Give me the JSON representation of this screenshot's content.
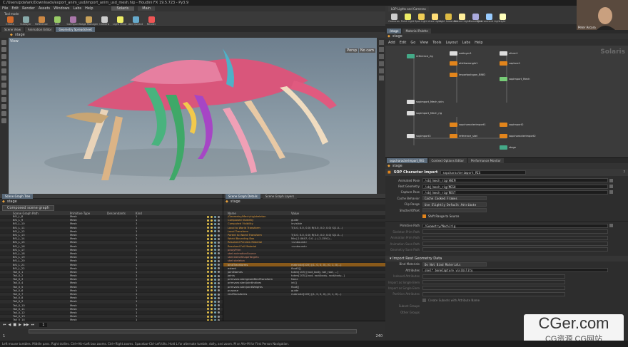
{
  "app": {
    "title": "C:/Users/pdafark/Downloads/export_anim_usd/import_anim_usd_mesh.hip - Houdini FX 19.5.723 - Py3.9",
    "menus": [
      "File",
      "Edit",
      "Render",
      "Assets",
      "Windows",
      "Labs",
      "Help"
    ],
    "desktop": "Solaris",
    "main_label": "Main"
  },
  "shelf": {
    "left_tab": "Tool mode",
    "tools": [
      "Create",
      "Sublayer",
      "Reference",
      "Edit",
      "Configure",
      "Stage Manager",
      "Camera",
      "Light Mixer",
      "Add Variant",
      "Render"
    ],
    "right_tools": [
      "Cameras",
      "Point Light",
      "Spot Light",
      "Area Light",
      "Light Instancer",
      "Distant Light",
      "Domelight",
      "Environment Light",
      "Light"
    ],
    "right_tab": "LOP Lights and Cameras"
  },
  "left_tabs": [
    "Scene View",
    "Animation Editor",
    "Geometry Spreadsheet"
  ],
  "viewport": {
    "stage_label": "stage",
    "view_label": "View",
    "persp": "Persp",
    "no_cam": "No cam"
  },
  "scene_graph": {
    "tab": "Scene Graph Tree",
    "path": "stage",
    "collection": "Composed scene graph",
    "columns": [
      "Scene Graph Path",
      "Primitive Type",
      "Descendants",
      "Kind"
    ],
    "rows": [
      [
        "Bf1_L_8",
        "Mesh",
        "",
        "1"
      ],
      [
        "Bf1_L_9",
        "Mesh",
        "",
        "1"
      ],
      [
        "Bf1_L_10",
        "Mesh",
        "",
        "1"
      ],
      [
        "Bf1_L_11",
        "Mesh",
        "",
        "1"
      ],
      [
        "Bf1_L_12",
        "Mesh",
        "",
        "1"
      ],
      [
        "Bf1_L_13",
        "Mesh",
        "",
        "1"
      ],
      [
        "Bf1_L_14",
        "Mesh",
        "",
        "1"
      ],
      [
        "Bf1_L_15",
        "Mesh",
        "",
        "1"
      ],
      [
        "Bf1_L_16",
        "Mesh",
        "",
        "1"
      ],
      [
        "Bf1_L_17",
        "Mesh",
        "",
        "1"
      ],
      [
        "Bf1_L_18",
        "Mesh",
        "",
        "1"
      ],
      [
        "Bf1_L_19",
        "Mesh",
        "",
        "1"
      ],
      [
        "Bf1_L_20",
        "Mesh",
        "",
        "1"
      ],
      [
        "Bf1_L_21",
        "Mesh",
        "",
        "1"
      ],
      [
        "Bf1_L_22",
        "Mesh",
        "",
        "1"
      ],
      [
        "Tail_0_1",
        "Mesh",
        "",
        "1"
      ],
      [
        "Tail_0_2",
        "Mesh",
        "",
        "1"
      ],
      [
        "Tail_0_3",
        "Mesh",
        "",
        "1"
      ],
      [
        "Tail_0_4",
        "Mesh",
        "",
        "1"
      ],
      [
        "Tail_0_5",
        "Mesh",
        "",
        "1"
      ],
      [
        "Tail_0_6",
        "Mesh",
        "",
        "1"
      ],
      [
        "Tail_0_7",
        "Mesh",
        "",
        "1"
      ],
      [
        "Tail_0_8",
        "Mesh",
        "",
        "1"
      ],
      [
        "Tail_0_9",
        "Mesh",
        "",
        "1"
      ],
      [
        "Tail_0_10",
        "Mesh",
        "",
        "1"
      ],
      [
        "Tail_0_11",
        "Mesh",
        "",
        "1"
      ],
      [
        "Tail_0_12",
        "Mesh",
        "",
        "1"
      ],
      [
        "Tail_0_13",
        "Mesh",
        "",
        "1"
      ],
      [
        "Tail_0_14",
        "Mesh",
        "",
        "1"
      ],
      [
        "Tail_0_15",
        "Mesh",
        "",
        "1"
      ],
      [
        "Tail_0_16",
        "Mesh",
        "",
        "1"
      ],
      [
        "Tail_0_17",
        "Mesh",
        "",
        "1"
      ],
      [
        "Skeleton",
        "Skeleton",
        "",
        "1"
      ],
      [
        "Skel",
        "SkelAnimation",
        "",
        ""
      ],
      [
        "Xform",
        "Xform",
        "22",
        ""
      ]
    ]
  },
  "details": {
    "tabs": [
      "Scene Graph Details",
      "Scene Graph Layers"
    ],
    "path": "stage",
    "columns": [
      "Name",
      "Value"
    ],
    "rows": [
      [
        "/Geometry/Mech/rig/skeleton",
        ""
      ],
      [
        "Composed Visibility",
        "guide"
      ],
      [
        "Computed Visibility",
        "invisible"
      ],
      [
        "Local to World Transform",
        "T(0.0, 0.0, 0.0) R(0.0, 0.0, 0.0) S(1.0...)"
      ],
      [
        "Local Transform",
        ""
      ],
      [
        "Parent to World Transform",
        "T(0.0, 0.0, 0.0) R(0.0, 0.0, 0.0) S(1.0...)"
      ],
      [
        "World Bounding Box",
        "Min(-2.0647, 0.0...) (-2.1591)..."
      ],
      [
        "Resolved Preview Material",
        "<unbound>"
      ],
      [
        "Resolved Full Material",
        "<unbound>"
      ],
      [
        "proxyPrim",
        ""
      ],
      [
        "skel:animationSource",
        ""
      ],
      [
        "skel:blendShapeTargets",
        ""
      ],
      [
        "skel:skeleton",
        ""
      ],
      [
        "bindTransforms",
        "matrix4d[105] ((1, 0, 0, 0), (0, 1, 0)...)"
      ],
      [
        "extent",
        "float3[]"
      ],
      [
        "jointNames",
        "token[105] [root_body, tail_root, ...]"
      ],
      [
        "joints",
        "token[105] [root, root/body, root/body...]"
      ],
      [
        "primvars:skel:geomBindTransform",
        "None"
      ],
      [
        "primvars:skel:jointIndices",
        "int[]"
      ],
      [
        "primvars:skel:jointWeights",
        "float[]"
      ],
      [
        "purpose",
        "guide"
      ],
      [
        "restTransforms",
        "matrix4d[105] ((1, 0, 0, 0), (0, 1, 0)...)"
      ]
    ]
  },
  "network": {
    "tabs": [
      "/stage",
      "Material Palette"
    ],
    "menus": [
      "Add",
      "Edit",
      "Go",
      "View",
      "Tools",
      "Layout",
      "Labs",
      "Help"
    ],
    "label": "Solaris",
    "path": "stage",
    "nodes": [
      "sublayer1",
      "xform1",
      "attribwrangle1",
      "importpolygon_BIND",
      "reference_rig",
      "capture1",
      "sopimport_Mech",
      "sopimport_Mech_skin",
      "sopimport_Mech_rig",
      "sopcharacterimport1",
      "sopimport2",
      "sopimport3",
      "reference_skel",
      "sopcharacterimport2",
      "stage"
    ]
  },
  "params": {
    "tabs": [
      "sopcharacterimport_RIG",
      "Context Options Editor",
      "Performance Monitor"
    ],
    "node_type": "SOP Character Import",
    "node_name": "sopcharacterimport_RIG",
    "fields": [
      [
        "Animated Pose",
        "/obj/mech_rig/ANIM"
      ],
      [
        "Rest Geometry",
        "/obj/mech_rig/MESH"
      ],
      [
        "Capture Pose",
        "/obj/mech_rig/REST"
      ],
      [
        "Cache Behavior",
        "Cache Cooked Frames"
      ],
      [
        "Clip Range",
        "Use Slightly Default Attribute"
      ],
      [
        "Shutter/Offset",
        ""
      ]
    ],
    "shift_label": "Shift Range to Source",
    "prim_path_label": "Primitive Path",
    "prim_path": "/Geometry/Mech/rig",
    "dim_fields": [
      "Skeleton Prim Path",
      "Animation Prim Path",
      "Animation Save Path",
      "Geometry Save Path"
    ],
    "section": "Import Rest Geometry Data",
    "bind_label": "Bind Materials",
    "bind_value": "Do Not Bind Materials",
    "attr_label": "Attributes",
    "attr_value": "skel* boneCapture visibility",
    "extra": [
      "Indexed Attributes",
      "Import as Single Elem",
      "Import as Single Elem",
      "Partition Attributes"
    ],
    "subset_label": "Create Subsets with Attribute Name",
    "subset_groups": "Subset Groups",
    "other_groups": "Other Groups"
  },
  "timeline": {
    "start": "1",
    "end": "240",
    "current": "1"
  },
  "status": "Left mouse tumbles. Middle pans. Right dollies. Ctrl+Alt+Left box zooms. Ctrl+Right zooms. Spacebar-Ctrl-Left tilts. Hold L for alternate tumble, dolly, and zoom.   M or Alt+M for First Person Navigation.",
  "webcam_name": "Peter Arcara",
  "watermark": {
    "logo": "CGer.com",
    "sub": "CG资源 CG网站"
  },
  "colors": {
    "accent": "#e2851c",
    "sel": "#8a5a1a",
    "mint": "#49b37e",
    "pink": "#d9567b"
  }
}
